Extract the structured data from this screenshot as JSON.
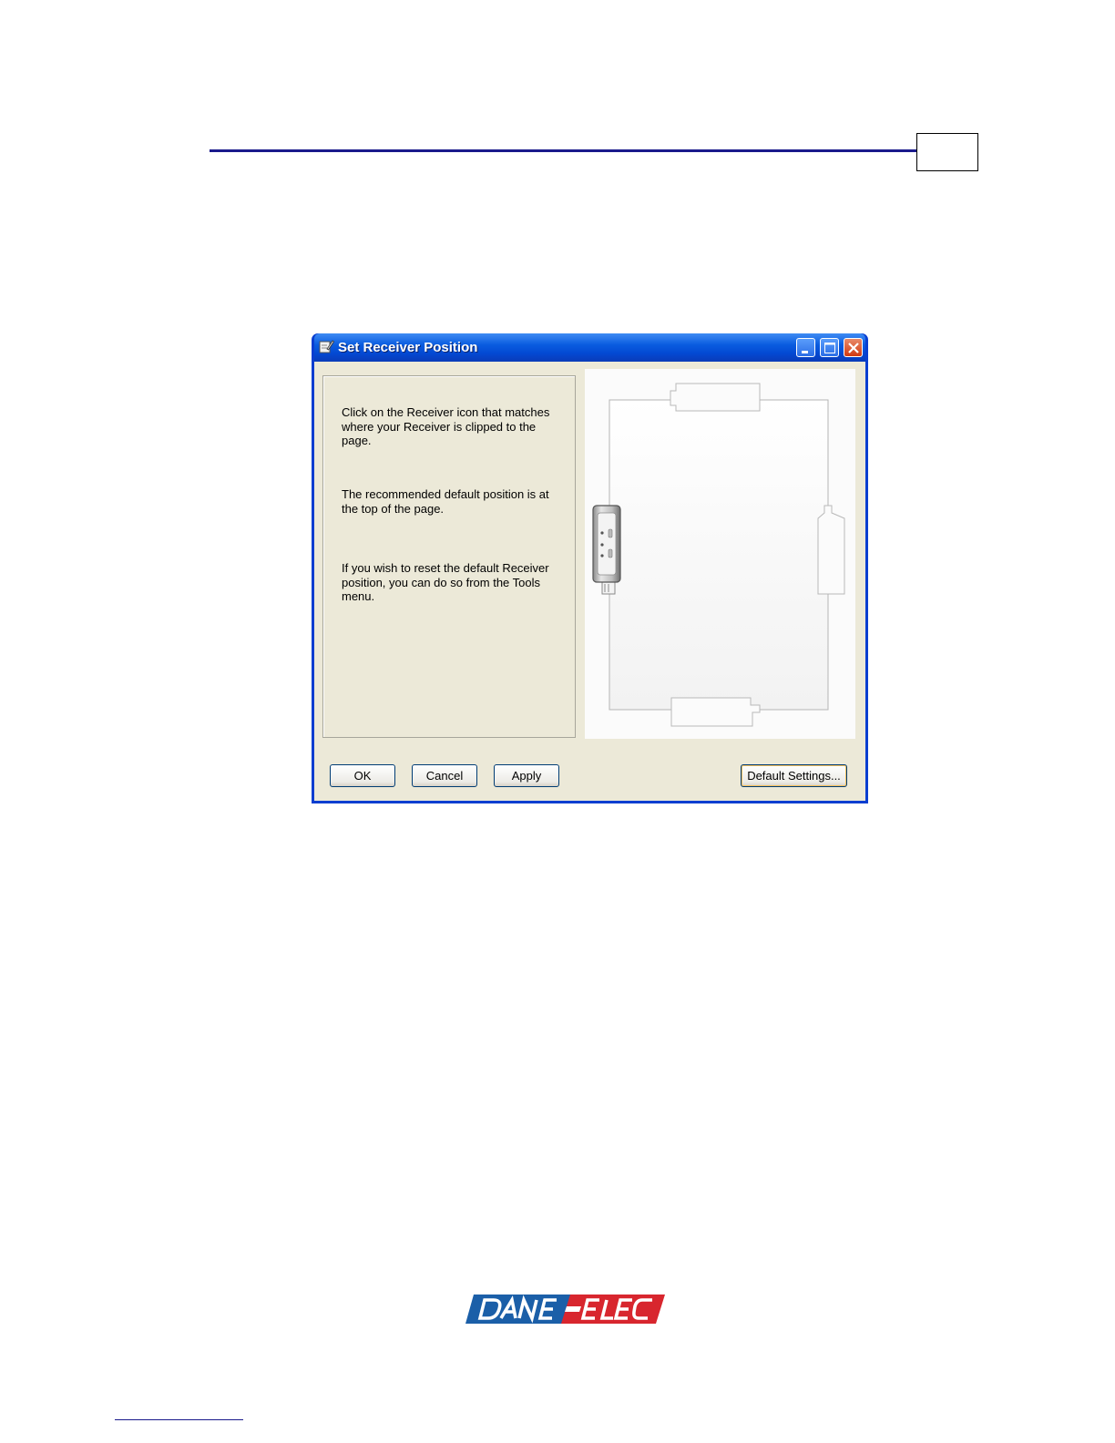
{
  "window": {
    "title": "Set Receiver Position"
  },
  "instructions": {
    "paragraph1": "Click on the Receiver icon that matches where your Receiver is clipped to the page.",
    "paragraph2": "The recommended default position is at the top of the page.",
    "paragraph3": "If you wish to reset the default Receiver position, you can do so from the Tools menu."
  },
  "buttons": {
    "ok": "OK",
    "cancel": "Cancel",
    "apply": "Apply",
    "default_settings": "Default Settings..."
  },
  "receiver": {
    "selected_position": "left",
    "positions": [
      "top",
      "left",
      "right",
      "bottom"
    ]
  },
  "logo": {
    "text": "DANE-ELEC",
    "colors": [
      "#1b5fa8",
      "#d8262e"
    ]
  },
  "colors": {
    "titlebar": "#0a5ce0",
    "dialog_bg": "#ece9d8",
    "header_rule": "#1a1a8c"
  }
}
